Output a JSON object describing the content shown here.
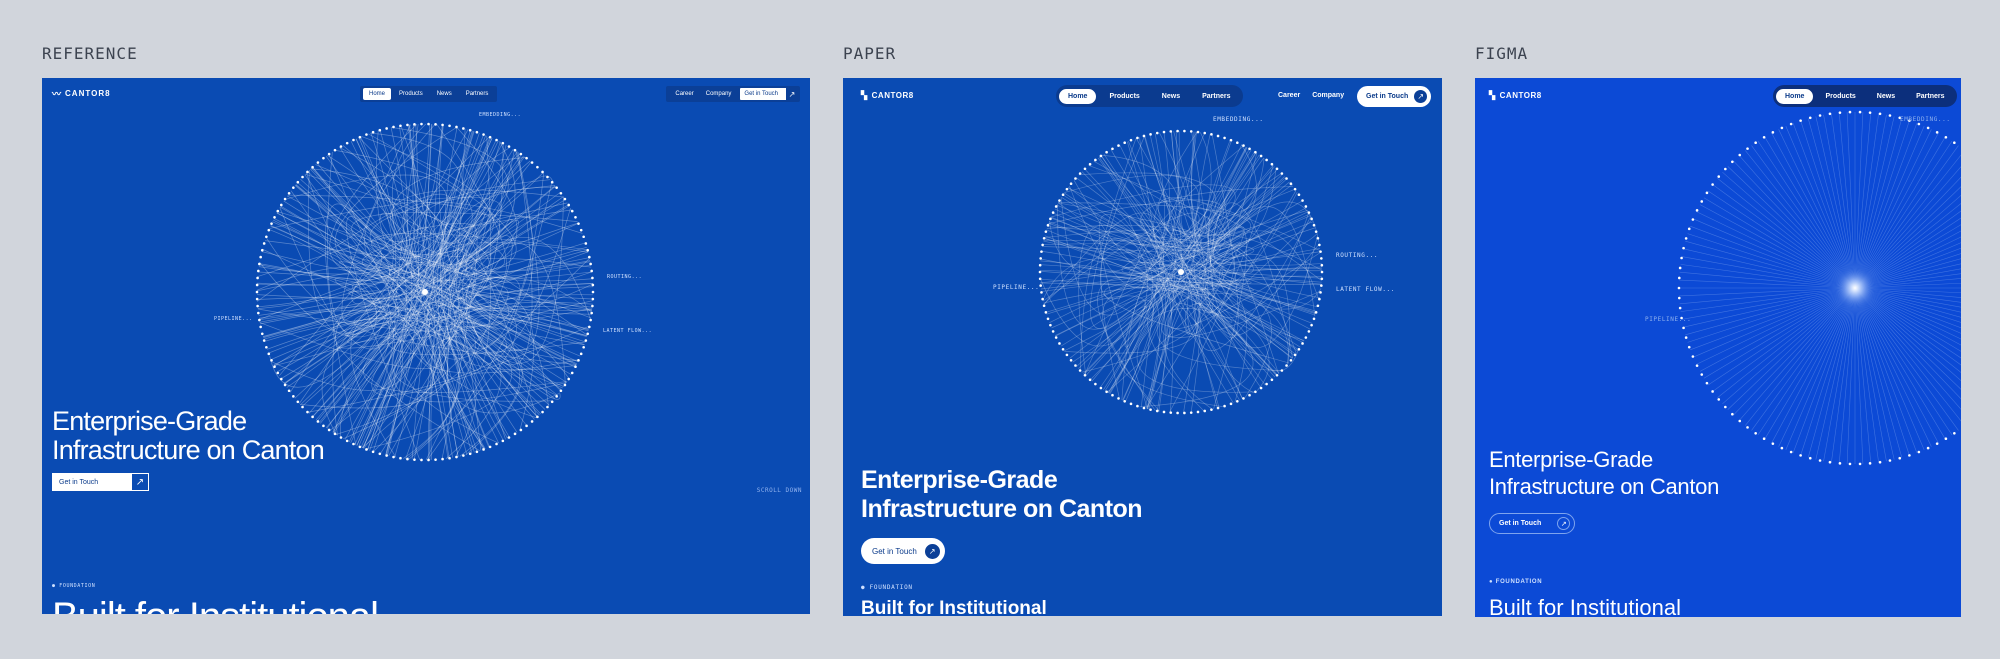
{
  "columns": {
    "reference": "REFERENCE",
    "paper": "PAPER",
    "figma": "FIGMA"
  },
  "colors": {
    "page_bg": "#d1d5dc",
    "reference_bg": "#0a4bb3",
    "paper_bg": "#0a4bb3",
    "figma_bg": "#0c4ad6"
  },
  "reference": {
    "logo": "CANTOR8",
    "nav": [
      "Home",
      "Products",
      "News",
      "Partners"
    ],
    "nav_active": "Home",
    "career": "Career",
    "company": "Company",
    "cta": "Get in Touch",
    "diagram_labels": {
      "embedding": "EMBEDDING...",
      "pipeline": "PIPELINE...",
      "routing": "ROUTING...",
      "latent": "LATENT FLOW..."
    },
    "headline_line1": "Enterprise-Grade",
    "headline_line2": "Infrastructure on Canton",
    "button": "Get in Touch",
    "scroll": "SCROLL DOWN",
    "foundation": "FOUNDATION",
    "section_title": "Built for Institutional"
  },
  "paper": {
    "logo": "CANTOR8",
    "nav": [
      "Home",
      "Products",
      "News",
      "Partners"
    ],
    "nav_active": "Home",
    "career": "Career",
    "company": "Company",
    "cta": "Get in Touch",
    "diagram_labels": {
      "embedding": "EMBEDDING...",
      "pipeline": "PIPELINE...",
      "routing": "ROUTING...",
      "latent": "LATENT FLOW..."
    },
    "headline_line1": "Enterprise-Grade",
    "headline_line2": "Infrastructure on Canton",
    "button": "Get in Touch",
    "foundation": "FOUNDATION",
    "section_title": "Built for Institutional"
  },
  "figma": {
    "logo": "CANTOR8",
    "nav": [
      "Home",
      "Products",
      "News",
      "Partners"
    ],
    "nav_active": "Home",
    "diagram_labels": {
      "embedding": "EMBEDDING...",
      "pipeline": "PIPELINE..."
    },
    "headline_line1": "Enterprise-Grade",
    "headline_line2": "Infrastructure on Canton",
    "button": "Get in Touch",
    "foundation": "FOUNDATION",
    "section_title": "Built for Institutional"
  }
}
